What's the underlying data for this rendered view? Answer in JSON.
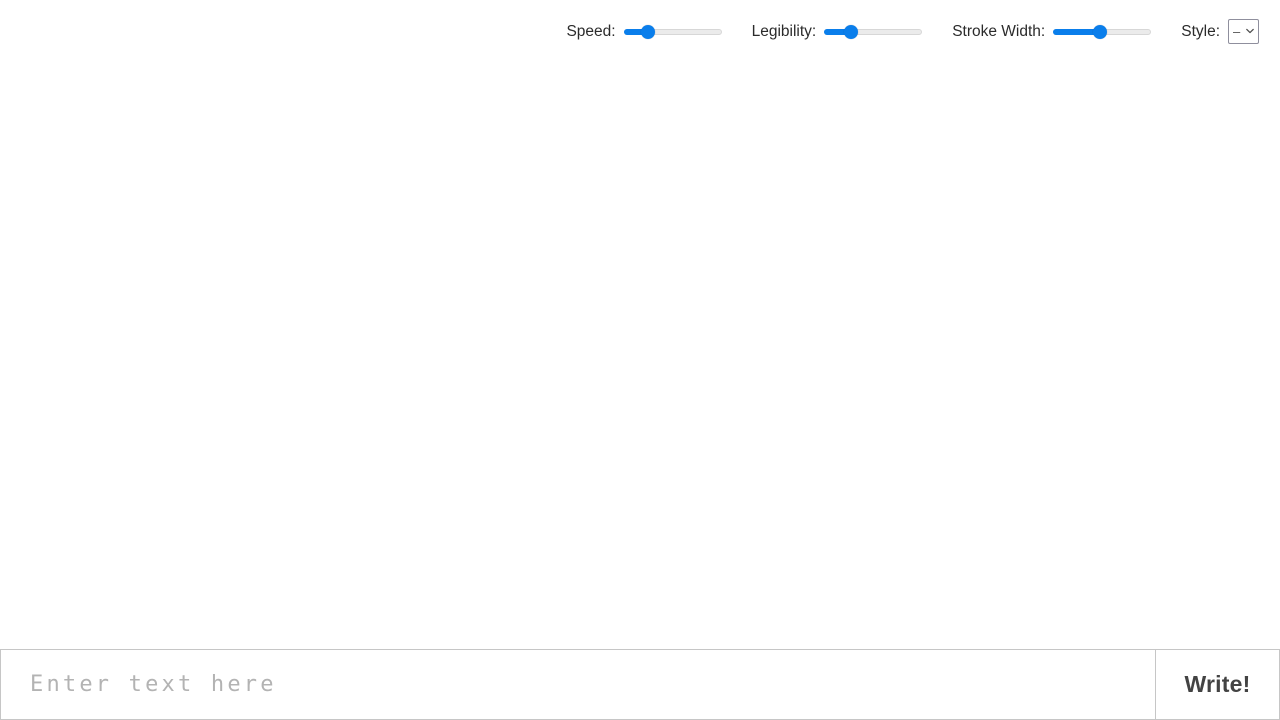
{
  "toolbar": {
    "controls": [
      {
        "name": "speed",
        "label": "Speed:",
        "type": "slider",
        "value": 25,
        "min": 0,
        "max": 100,
        "fill_color": "#0a7eeb",
        "track_color": "#ebebeb"
      },
      {
        "name": "legibility",
        "label": "Legibility:",
        "type": "slider",
        "value": 27,
        "min": 0,
        "max": 100,
        "fill_color": "#0a7eeb",
        "track_color": "#ebebeb"
      },
      {
        "name": "stroke-width",
        "label": "Stroke Width:",
        "type": "slider",
        "value": 48,
        "min": 0,
        "max": 100,
        "fill_color": "#0a7eeb",
        "track_color": "#ebebeb"
      },
      {
        "name": "style",
        "label": "Style:",
        "type": "select",
        "selected": "–",
        "options": [
          "–"
        ],
        "chevron_icon": "chevron-down-icon"
      }
    ]
  },
  "canvas": {
    "content": "",
    "background": "#ffffff"
  },
  "bottom": {
    "input": {
      "value": "",
      "placeholder": "Enter text here"
    },
    "write_label": "Write!"
  }
}
